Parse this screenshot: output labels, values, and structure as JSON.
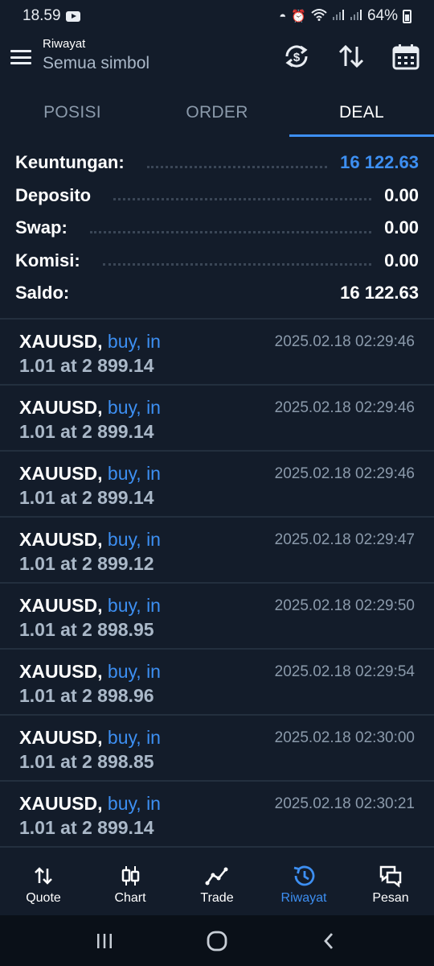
{
  "status": {
    "time": "18.59",
    "battery": "64%"
  },
  "header": {
    "subtitle": "Riwayat",
    "title": "Semua simbol"
  },
  "tabs": [
    {
      "label": "POSISI",
      "active": false
    },
    {
      "label": "ORDER",
      "active": false
    },
    {
      "label": "DEAL",
      "active": true
    }
  ],
  "summary": [
    {
      "label": "Keuntungan:",
      "value": "16 122.63"
    },
    {
      "label": "Deposito",
      "value": "0.00"
    },
    {
      "label": "Swap:",
      "value": "0.00"
    },
    {
      "label": "Komisi:",
      "value": "0.00"
    },
    {
      "label": "Saldo:",
      "value": "16 122.63"
    }
  ],
  "deals": [
    {
      "symbol": "XAUUSD,",
      "type": "buy, in",
      "detail": "1.01 at 2 899.14",
      "time": "2025.02.18 02:29:46"
    },
    {
      "symbol": "XAUUSD,",
      "type": "buy, in",
      "detail": "1.01 at 2 899.14",
      "time": "2025.02.18 02:29:46"
    },
    {
      "symbol": "XAUUSD,",
      "type": "buy, in",
      "detail": "1.01 at 2 899.14",
      "time": "2025.02.18 02:29:46"
    },
    {
      "symbol": "XAUUSD,",
      "type": "buy, in",
      "detail": "1.01 at 2 899.12",
      "time": "2025.02.18 02:29:47"
    },
    {
      "symbol": "XAUUSD,",
      "type": "buy, in",
      "detail": "1.01 at 2 898.95",
      "time": "2025.02.18 02:29:50"
    },
    {
      "symbol": "XAUUSD,",
      "type": "buy, in",
      "detail": "1.01 at 2 898.96",
      "time": "2025.02.18 02:29:54"
    },
    {
      "symbol": "XAUUSD,",
      "type": "buy, in",
      "detail": "1.01 at 2 898.85",
      "time": "2025.02.18 02:30:00"
    },
    {
      "symbol": "XAUUSD,",
      "type": "buy, in",
      "detail": "1.01 at 2 899.14",
      "time": "2025.02.18 02:30:21"
    }
  ],
  "nav": [
    {
      "label": "Quote",
      "icon": "quote-arrows-icon",
      "active": false
    },
    {
      "label": "Chart",
      "icon": "candlestick-icon",
      "active": false
    },
    {
      "label": "Trade",
      "icon": "trade-line-icon",
      "active": false
    },
    {
      "label": "Riwayat",
      "icon": "history-icon",
      "active": true
    },
    {
      "label": "Pesan",
      "icon": "messages-icon",
      "active": false
    }
  ],
  "colors": {
    "background": "#131c2a",
    "accent": "#3d8ff2",
    "muted": "#8b9aab",
    "secondary_text": "#aab8c8"
  }
}
